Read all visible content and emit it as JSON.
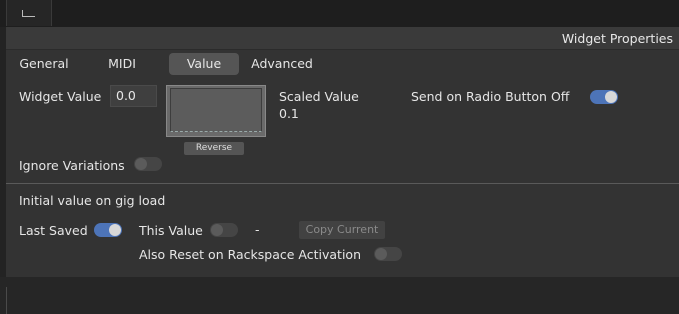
{
  "panel": {
    "title": "Widget Properties"
  },
  "tabs": [
    {
      "label": "General",
      "active": false
    },
    {
      "label": "MIDI",
      "active": false
    },
    {
      "label": "Value",
      "active": true
    },
    {
      "label": "Advanced",
      "active": false
    }
  ],
  "value_tab": {
    "widget_value_label": "Widget Value",
    "widget_value": "0.0",
    "reverse_label": "Reverse",
    "scaled_value_label": "Scaled Value",
    "scaled_value": "0.1",
    "send_on_radio_label": "Send on Radio Button Off",
    "send_on_radio_on": true,
    "ignore_variations_label": "Ignore Variations",
    "ignore_variations_on": false,
    "initial_value_heading": "Initial value on gig load",
    "last_saved_label": "Last Saved",
    "last_saved_on": true,
    "this_value_label": "This Value",
    "this_value_on": false,
    "this_value_display": "-",
    "copy_current_label": "Copy Current",
    "also_reset_label": "Also Reset on Rackspace Activation",
    "also_reset_on": false
  },
  "colors": {
    "toggle_on": "#4d74b8",
    "active_tab": "#555555",
    "panel_bg": "#333333"
  }
}
